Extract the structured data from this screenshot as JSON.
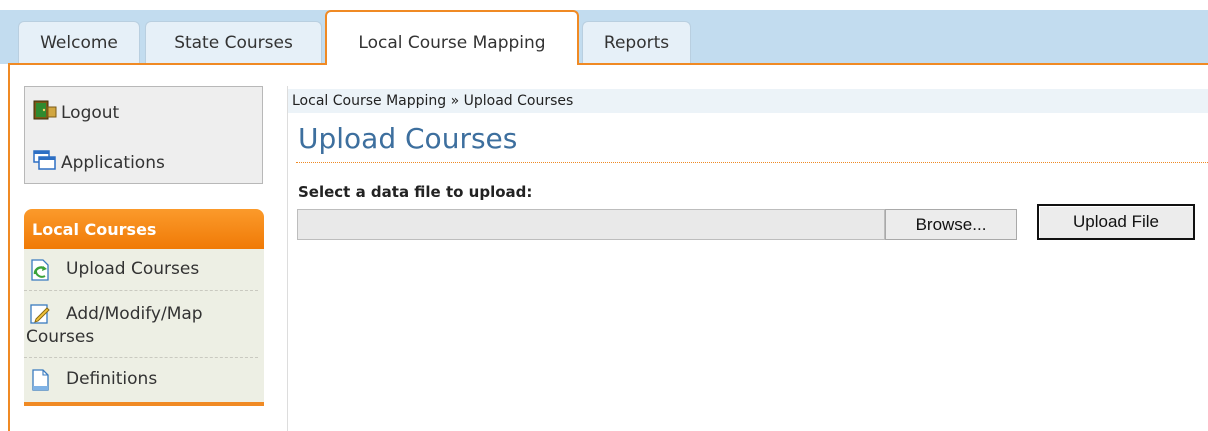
{
  "tabs": [
    {
      "label": "Welcome",
      "active": false
    },
    {
      "label": "State Courses",
      "active": false
    },
    {
      "label": "Local Course Mapping",
      "active": true
    },
    {
      "label": "Reports",
      "active": false
    }
  ],
  "quick_links": [
    {
      "label": "Logout",
      "icon": "logout-door-icon"
    },
    {
      "label": "Applications",
      "icon": "applications-windows-icon"
    }
  ],
  "sidebar": {
    "header": "Local Courses",
    "items": [
      {
        "label": "Upload Courses",
        "icon": "upload-courses-icon"
      },
      {
        "label": "Add/Modify/Map Courses",
        "icon": "edit-courses-icon"
      },
      {
        "label": "Definitions",
        "icon": "document-icon"
      }
    ]
  },
  "main": {
    "breadcrumb": "Local Course Mapping » Upload Courses",
    "title": "Upload Courses",
    "file_label": "Select a data file to upload:",
    "file_value": "",
    "browse_label": "Browse...",
    "upload_label": "Upload File"
  },
  "colors": {
    "accent_orange": "#f08a24",
    "title_blue": "#3d6f9e",
    "tab_band": "#c2dcef"
  }
}
